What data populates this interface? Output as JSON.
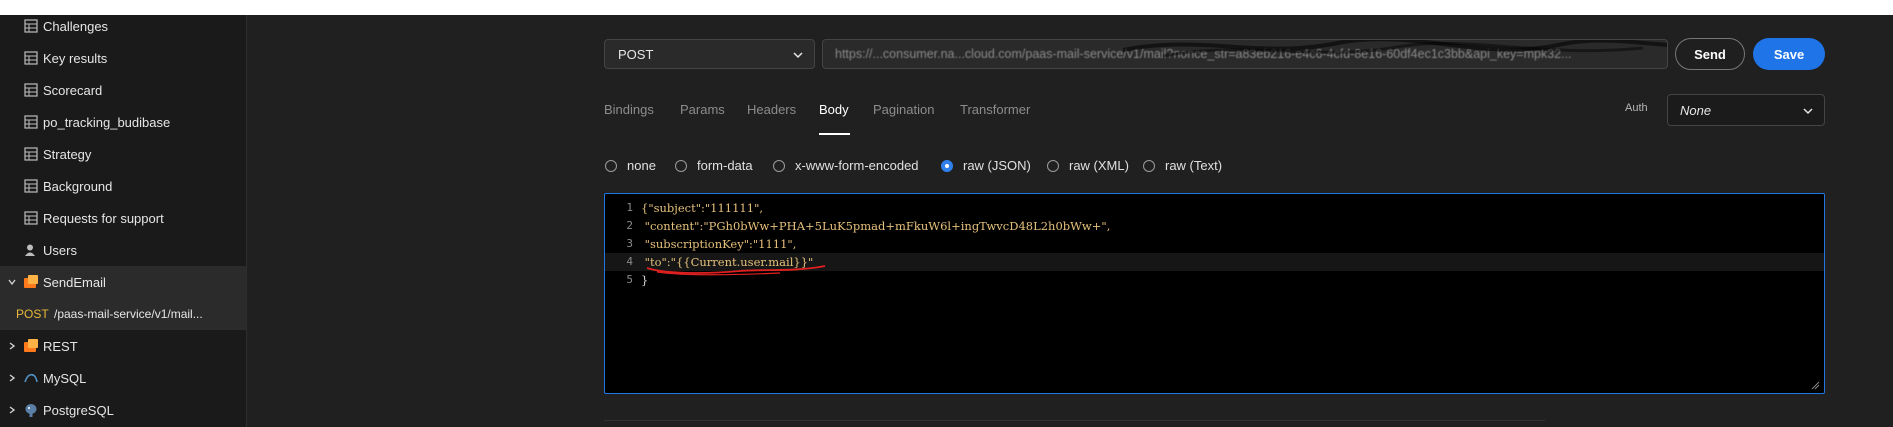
{
  "sidebar": {
    "items": [
      {
        "label": "Challenges",
        "icon": "table-icon"
      },
      {
        "label": "Key results",
        "icon": "table-icon"
      },
      {
        "label": "Scorecard",
        "icon": "table-icon"
      },
      {
        "label": "po_tracking_budibase",
        "icon": "table-icon"
      },
      {
        "label": "Strategy",
        "icon": "table-icon"
      },
      {
        "label": "Background",
        "icon": "table-icon"
      },
      {
        "label": "Requests for support",
        "icon": "table-icon"
      },
      {
        "label": "Users",
        "icon": "users-icon"
      },
      {
        "label": "SendEmail",
        "icon": "rest-datasource-icon"
      },
      {
        "label": "REST",
        "icon": "rest-datasource-icon"
      },
      {
        "label": "MySQL",
        "icon": "mysql-icon"
      },
      {
        "label": "PostgreSQL",
        "icon": "postgresql-icon"
      }
    ],
    "query": {
      "method": "POST",
      "path": "/paas-mail-service/v1/mail..."
    }
  },
  "request": {
    "method": "POST",
    "url": "https://...consumer.na...cloud.com/paas-mail-service/v1/mail?nonce_str=a83eb216-e4c6-4cfd-8e16-60df4ec1c3bb&api_key=mpk32...",
    "send_label": "Send",
    "save_label": "Save"
  },
  "tabs": [
    "Bindings",
    "Params",
    "Headers",
    "Body",
    "Pagination",
    "Transformer"
  ],
  "active_tab": "Body",
  "auth": {
    "label": "Auth",
    "value": "None"
  },
  "body_types": [
    "none",
    "form-data",
    "x-www-form-encoded",
    "raw (JSON)",
    "raw (XML)",
    "raw (Text)"
  ],
  "selected_body_type": "raw (JSON)",
  "editor": {
    "lines": [
      {
        "n": "1",
        "text": "{\"subject\":\"111111\","
      },
      {
        "n": "2",
        "text": " \"content\":\"PGh0bWw+PHA+5LuK5pmad+mFkuW6l+ingTwvcD48L2h0bWw+\","
      },
      {
        "n": "3",
        "text": " \"subscriptionKey\":\"1111\","
      },
      {
        "n": "4",
        "text": " \"to\":\"{{Current.user.mail}}\""
      },
      {
        "n": "5",
        "text": "}"
      }
    ]
  },
  "colors": {
    "accent": "#1f74e8",
    "post_method": "#e8b93a",
    "code_string": "#e5c07b",
    "annotation": "#e02020"
  }
}
